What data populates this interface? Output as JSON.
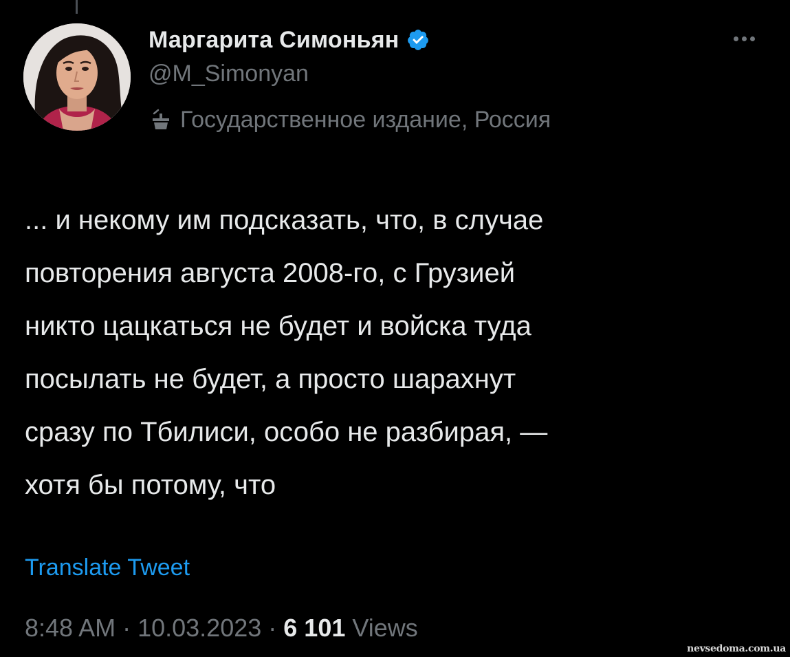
{
  "author": {
    "display_name": "Маргарита Симоньян",
    "handle": "@M_Simonyan",
    "label": "Государственное издание, Россия",
    "verified": true,
    "avatar_icon": "profile-photo",
    "verified_icon": "verified-badge-icon",
    "label_icon": "state-media-podium-icon",
    "verified_color": "#1d9bf0"
  },
  "tweet": {
    "lines": [
      "... и некому им подсказать, что, в случае",
      "повторения августа 2008-го, с Грузией",
      "никто цацкаться не будет и войска туда",
      "посылать не будет, а просто шарахнут",
      "сразу по Тбилиси, особо не разбирая, —",
      "хотя бы потому, что"
    ],
    "translate_label": "Translate Tweet",
    "time": "8:48 AM",
    "separator": " · ",
    "date": "10.03.2023",
    "views_count": "6 101",
    "views_label": " Views"
  },
  "more_icon": "more-dots-icon",
  "watermark": "nevsedoma.com.ua",
  "colors": {
    "background": "#000000",
    "text": "#e7e9ea",
    "secondary": "#71767b",
    "link": "#1d9bf0"
  }
}
